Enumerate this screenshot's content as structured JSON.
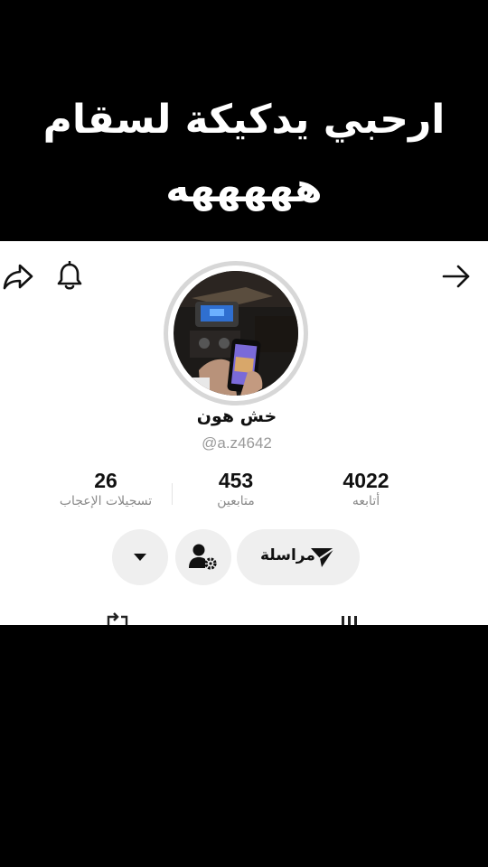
{
  "caption": {
    "line1": "ارحبي يدكيكة لسقام",
    "line2": "هههههه"
  },
  "toolbar": {
    "share_icon": "share-arrow-icon",
    "bell_icon": "bell-icon",
    "forward_icon": "arrow-right-icon"
  },
  "profile": {
    "name": "خش هون",
    "handle": "@a.z4642"
  },
  "stats": {
    "likes": {
      "value": "26",
      "label": "تسجيلات الإعجاب"
    },
    "followers": {
      "value": "453",
      "label": "متابعين"
    },
    "following": {
      "value": "4022",
      "label": "أتابعه"
    }
  },
  "actions": {
    "message_label": "مراسلة",
    "message_icon": "send-icon",
    "settings_icon": "user-settings-icon",
    "more_icon": "caret-down-icon"
  },
  "tabs": {
    "repost_icon": "repost-icon",
    "videos_icon": "videos-grid-icon"
  }
}
